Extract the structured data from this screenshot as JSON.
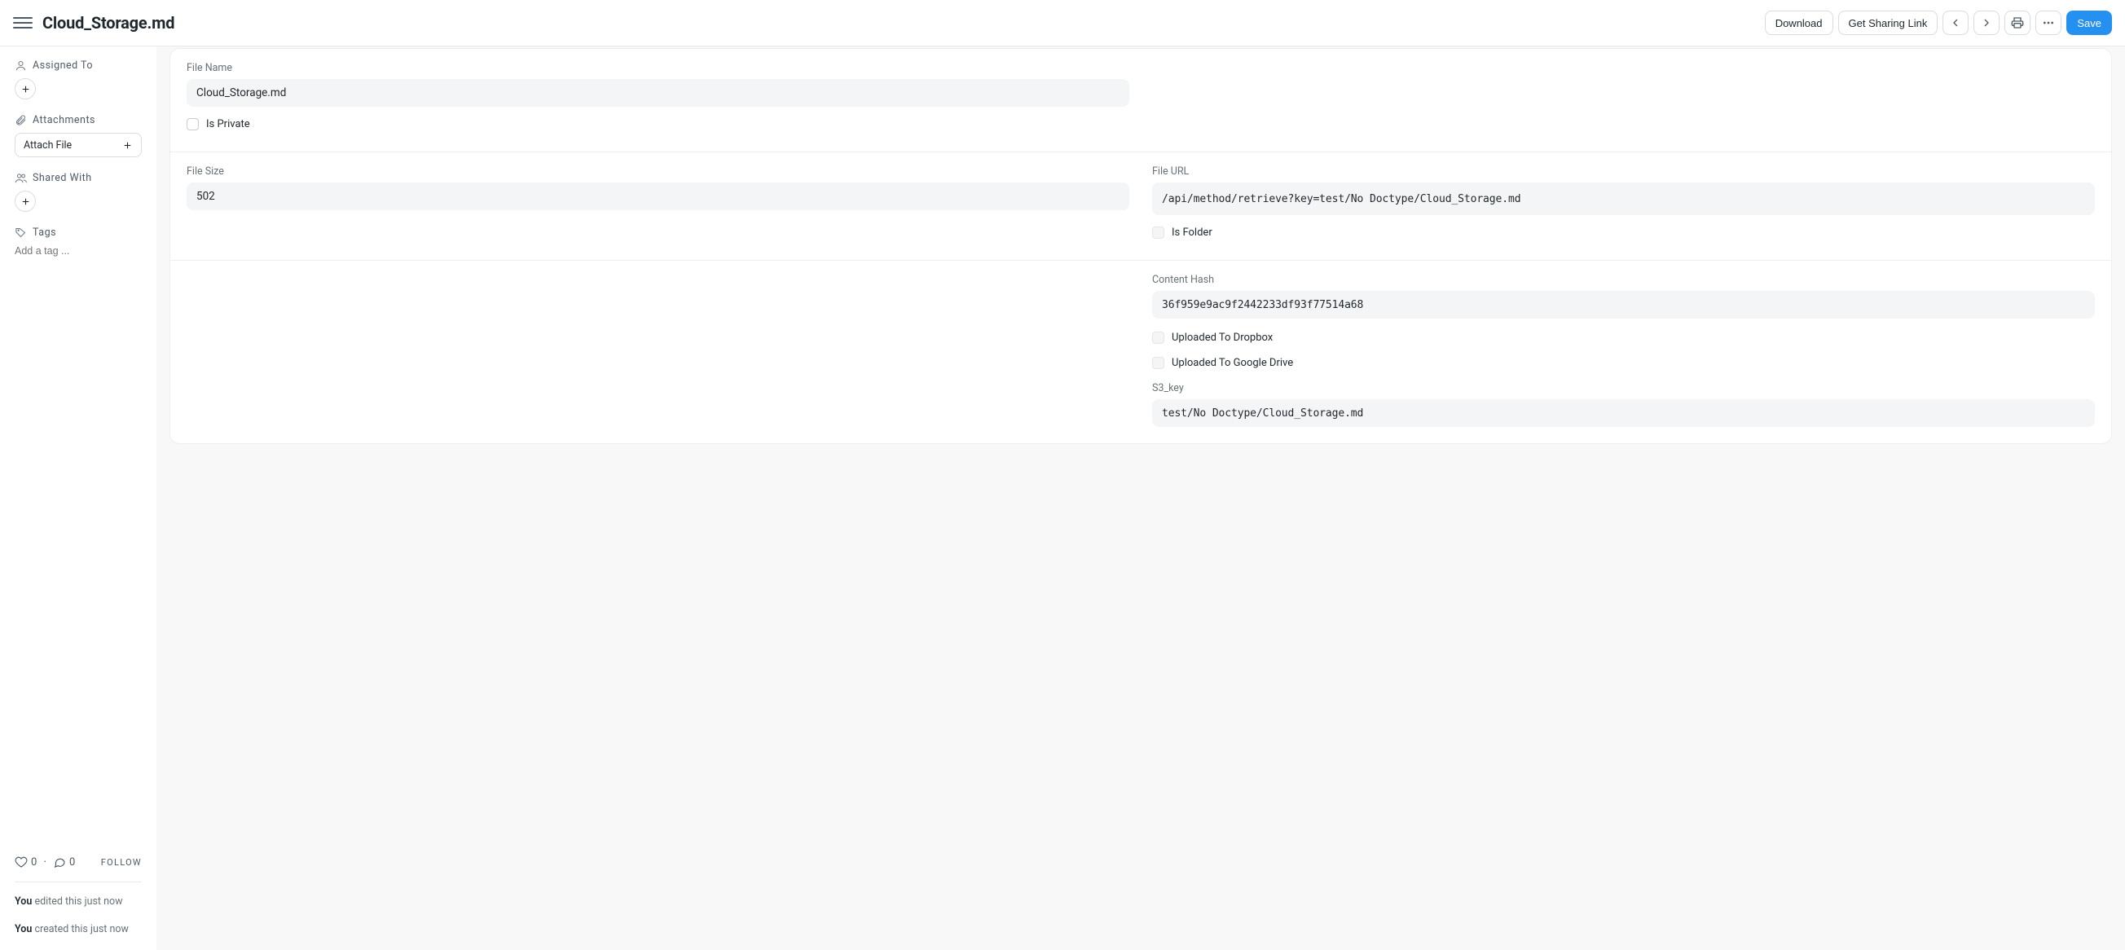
{
  "header": {
    "title": "Cloud_Storage.md",
    "download_label": "Download",
    "sharing_label": "Get Sharing Link",
    "save_label": "Save"
  },
  "sidebar": {
    "assigned_label": "Assigned To",
    "attachments_label": "Attachments",
    "attach_file_label": "Attach File",
    "shared_with_label": "Shared With",
    "tags_label": "Tags",
    "tags_placeholder": "Add a tag ...",
    "likes": "0",
    "comments": "0",
    "follow_label": "FOLLOW",
    "history": {
      "edited_you": "You",
      "edited_rest": " edited this just now",
      "created_you": "You",
      "created_rest": " created this just now"
    }
  },
  "form": {
    "file_name": {
      "label": "File Name",
      "value": "Cloud_Storage.md"
    },
    "is_private": {
      "label": "Is Private",
      "checked": false
    },
    "file_size": {
      "label": "File Size",
      "value": "502"
    },
    "file_url": {
      "label": "File URL",
      "value": "/api/method/retrieve?key=test/No Doctype/Cloud_Storage.md"
    },
    "is_folder": {
      "label": "Is Folder",
      "checked": false
    },
    "content_hash": {
      "label": "Content Hash",
      "value": "36f959e9ac9f2442233df93f77514a68"
    },
    "uploaded_dropbox": {
      "label": "Uploaded To Dropbox",
      "checked": false
    },
    "uploaded_gdrive": {
      "label": "Uploaded To Google Drive",
      "checked": false
    },
    "s3_key": {
      "label": "S3_key",
      "value": "test/No Doctype/Cloud_Storage.md"
    }
  }
}
